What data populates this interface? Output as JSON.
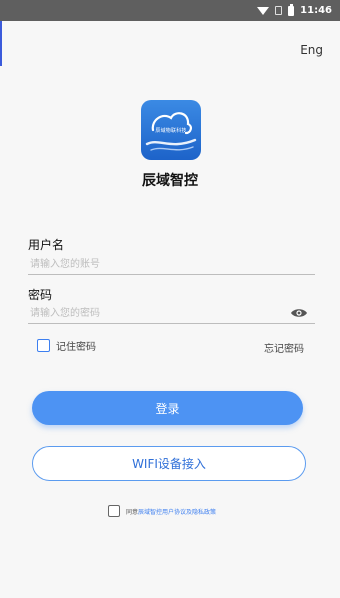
{
  "status_bar": {
    "time": "11:46",
    "icons": [
      "wifi-icon",
      "sim-icon",
      "battery-icon"
    ]
  },
  "header": {
    "language_label": "Eng"
  },
  "brand": {
    "logo_text": "辰域物联科技",
    "app_name": "辰域智控",
    "logo_color": "#2a78dc"
  },
  "form": {
    "username": {
      "label": "用户名",
      "placeholder": "请输入您的账号",
      "value": ""
    },
    "password": {
      "label": "密码",
      "placeholder": "请输入您的密码",
      "value": "",
      "toggle_icon": "eye-icon"
    },
    "remember_label": "记住密码",
    "forgot_label": "忘记密码"
  },
  "actions": {
    "login_label": "登录",
    "wifi_label": "WIFI设备接入"
  },
  "agreement": {
    "prefix": "同意",
    "link_text": "辰域智控用户协议及隐私政策"
  },
  "colors": {
    "primary": "#4d93f3",
    "accent_text": "#2f6fd8",
    "background": "#f7f7f7"
  }
}
